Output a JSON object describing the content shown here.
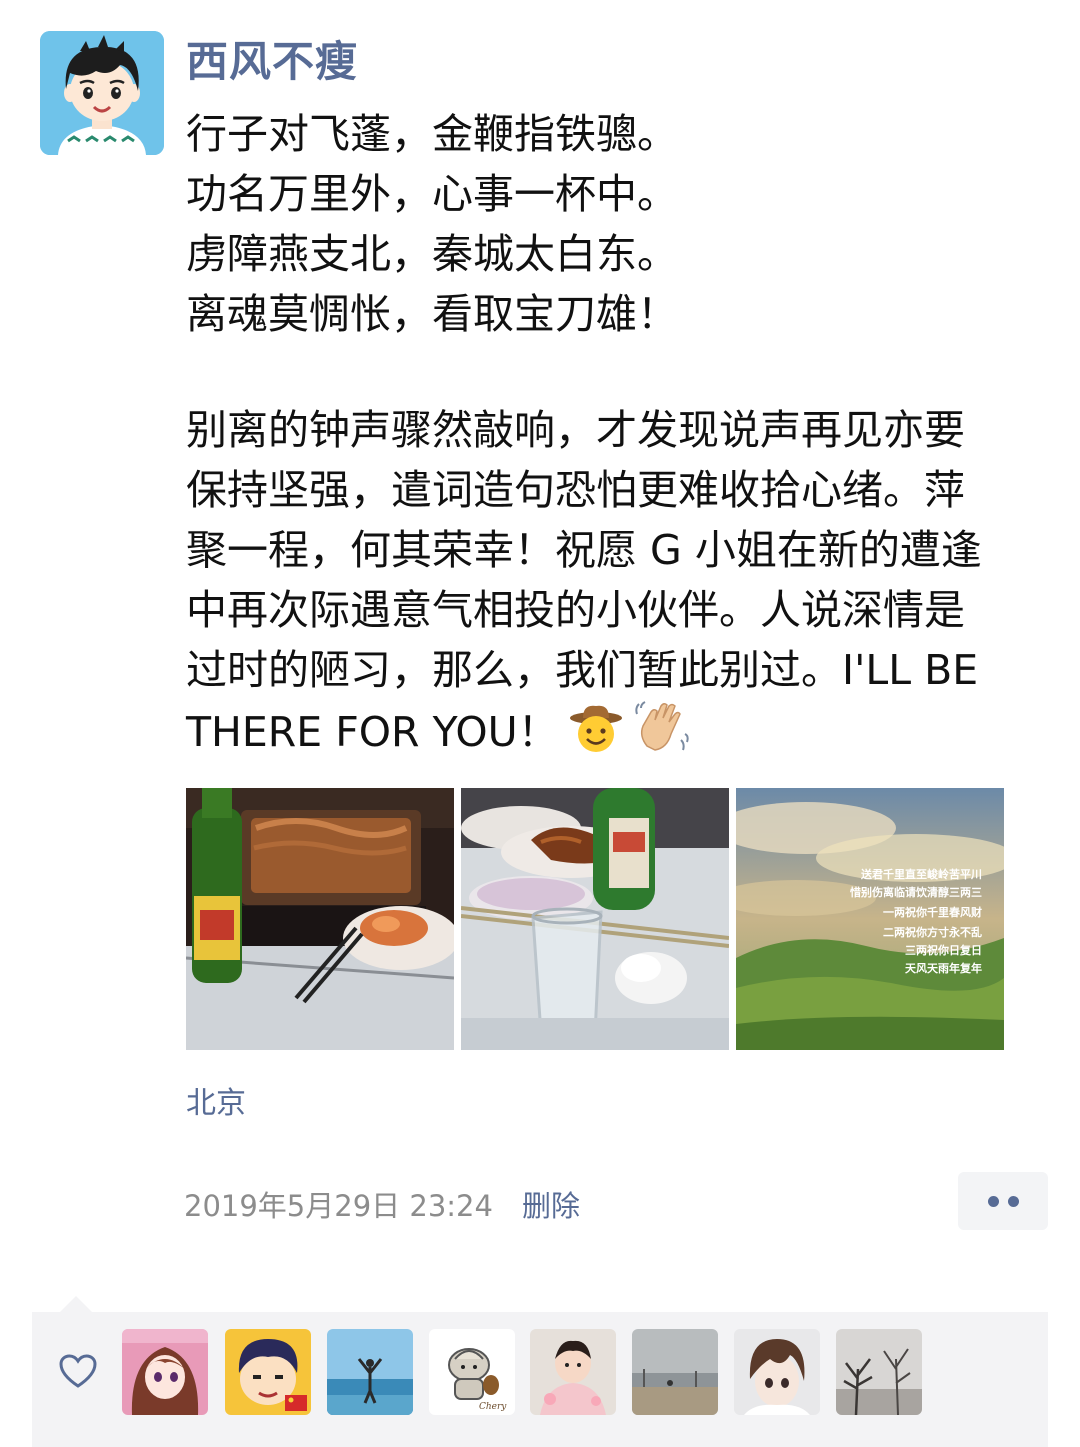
{
  "post": {
    "username": "西风不瘦",
    "poem_lines": [
      "行子对飞蓬，金鞭指铁骢。",
      "功名万里外，心事一杯中。",
      "虏障燕支北，秦城太白东。",
      "离魂莫惆怅，看取宝刀雄！"
    ],
    "paragraph_lines": [
      "别离的钟声骤然敲响，才发现说声再见亦要",
      "保持坚强，遣词造句恐怕更难收拾心绪。萍",
      "聚一程，何其荣幸！祝愿 G 小姐在新的遭逢",
      "中再次际遇意气相投的小伙伴。人说深情是",
      "过时的陋习，那么，我们暂此别过。I'LL BE",
      "THERE FOR YOU！"
    ],
    "emojis": [
      "cowboy-face",
      "waving-hand"
    ],
    "photos": [
      {
        "subject": "grilled fish tray with green beer bottle"
      },
      {
        "subject": "table with beer bottle, plates and empty glass"
      },
      {
        "subject": "landscape with clouds and green hills",
        "overlay_text": [
          "送君千里直至峻岭苦平川",
          "惜别伤离临请饮清醇三两三",
          "一两祝你千里春风财",
          "二两祝你方寸永不乱",
          "三两祝你日复日",
          "天风天雨年复年"
        ]
      }
    ],
    "location": "北京",
    "timestamp": "2019年5月29日 23:24",
    "delete_label": "删除"
  },
  "likes": {
    "icon": "heart-icon",
    "avatars": [
      "anime-girl-avatar",
      "cartoon-boy-avatar",
      "beach-person-avatar",
      "cartoon-character-avatar",
      "baby-photo-avatar",
      "seaside-photo-avatar",
      "anime-boy-avatar",
      "winter-tree-avatar"
    ]
  },
  "colors": {
    "link": "#576b95",
    "text": "#111111",
    "meta": "#8c8c8c",
    "panel": "#f3f3f5"
  }
}
